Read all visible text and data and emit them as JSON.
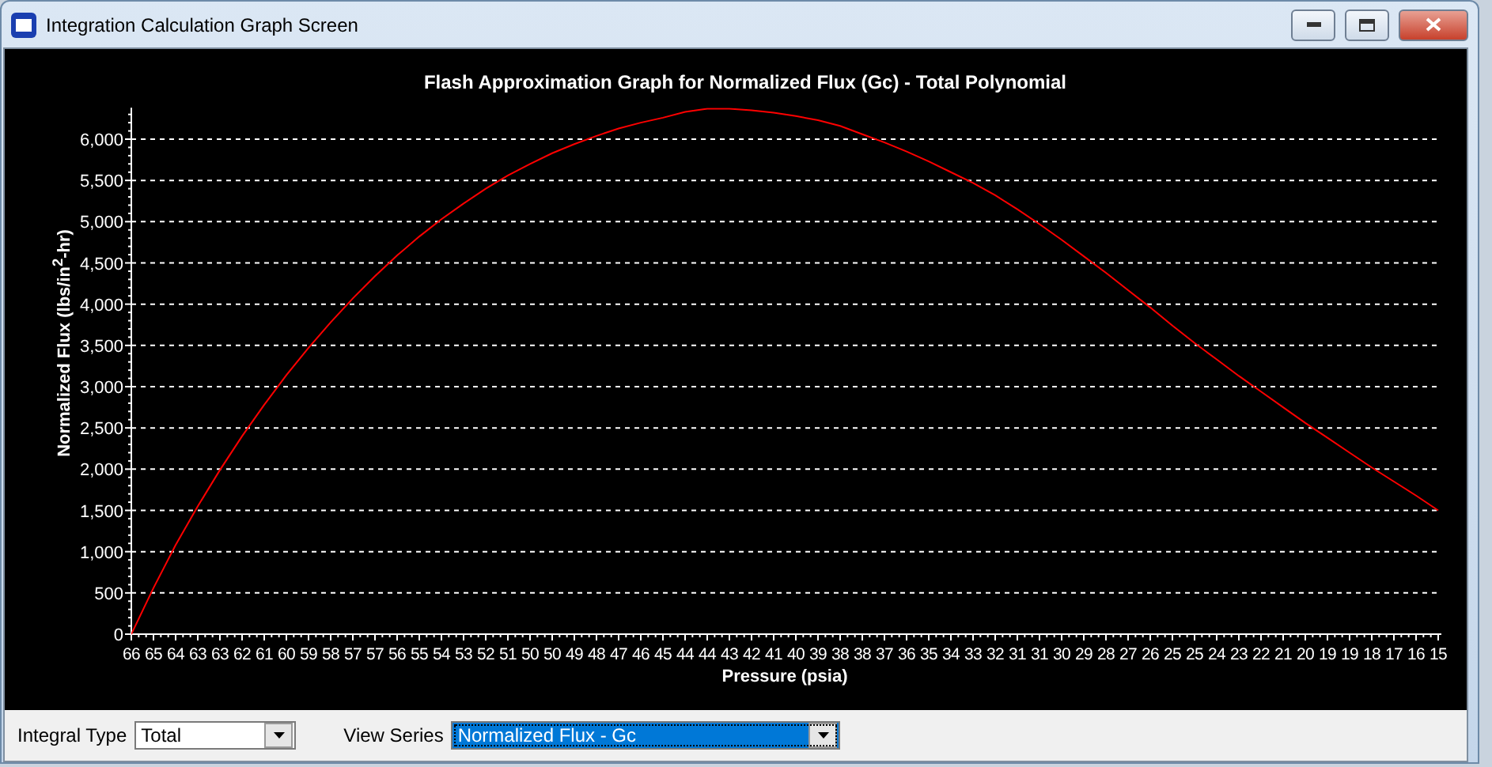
{
  "window": {
    "title": "Integration Calculation Graph Screen"
  },
  "chart": {
    "chart_data": {
      "type": "line",
      "title": "Flash Approximation Graph for Normalized Flux (Gc) - Total Polynomial",
      "xlabel": "Pressure (psia)",
      "ylabel": "Normalized Flux (lbs/in$^{2}$-hr)",
      "categories": [
        "66",
        "65",
        "64",
        "63",
        "63",
        "62",
        "61",
        "60",
        "59",
        "58",
        "57",
        "57",
        "56",
        "55",
        "54",
        "53",
        "52",
        "51",
        "50",
        "50",
        "49",
        "48",
        "47",
        "46",
        "45",
        "44",
        "44",
        "43",
        "42",
        "41",
        "40",
        "39",
        "38",
        "38",
        "37",
        "36",
        "35",
        "34",
        "33",
        "32",
        "31",
        "31",
        "30",
        "29",
        "28",
        "27",
        "26",
        "25",
        "25",
        "24",
        "23",
        "22",
        "21",
        "20",
        "19",
        "19",
        "18",
        "17",
        "16",
        "15"
      ],
      "grid": true,
      "series": [
        {
          "color": "#ff0000",
          "values": [
            0,
            560,
            1080,
            1550,
            1990,
            2400,
            2780,
            3140,
            3470,
            3780,
            4070,
            4340,
            4590,
            4820,
            5030,
            5220,
            5400,
            5560,
            5700,
            5830,
            5940,
            6040,
            6130,
            6200,
            6260,
            6330,
            6370,
            6370,
            6350,
            6320,
            6280,
            6230,
            6160,
            6060,
            5960,
            5850,
            5730,
            5600,
            5470,
            5320,
            5150,
            4970,
            4780,
            4580,
            4380,
            4170,
            3960,
            3740,
            3530,
            3330,
            3130,
            2940,
            2750,
            2560,
            2380,
            2200,
            2020,
            1850,
            1680,
            1500
          ]
        }
      ],
      "ylim": [
        0,
        6380
      ],
      "yticks": [
        {
          "value": 0,
          "label": "0"
        },
        {
          "value": 500,
          "label": "500"
        },
        {
          "value": 1000,
          "label": "1,000"
        },
        {
          "value": 1500,
          "label": "1,500"
        },
        {
          "value": 2000,
          "label": "2,000"
        },
        {
          "value": 2500,
          "label": "2,500"
        },
        {
          "value": 3000,
          "label": "3,000"
        },
        {
          "value": 3500,
          "label": "3,500"
        },
        {
          "value": 4000,
          "label": "4,000"
        },
        {
          "value": 4500,
          "label": "4,500"
        },
        {
          "value": 5000,
          "label": "5,000"
        },
        {
          "value": 5500,
          "label": "5,500"
        },
        {
          "value": 6000,
          "label": "6,000"
        }
      ]
    }
  },
  "controls": [
    {
      "label": "Integral Type",
      "value": "Total",
      "focused": false
    },
    {
      "label": "View Series",
      "value": "Normalized Flux - Gc",
      "focused": true
    }
  ]
}
